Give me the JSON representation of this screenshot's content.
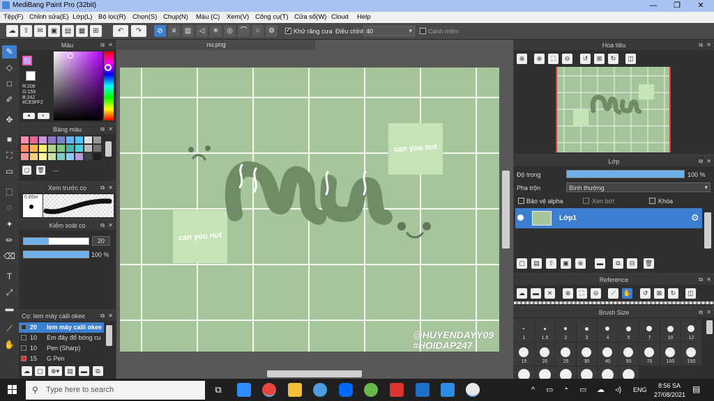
{
  "window": {
    "title": "MediBang Paint Pro (32bit)"
  },
  "menu": [
    "Tệp(F)",
    "Chỉnh sửa(E)",
    "Lớp(L)",
    "Bộ lọc(R)",
    "Chọn(S)",
    "Chụp(N)",
    "Màu (C)",
    "Xem(V)",
    "Công cụ(T)",
    "Cửa sổ(W)",
    "Cloud",
    "Help"
  ],
  "toolbar": {
    "antialias_label": "Khử răng cưa",
    "correction_label": "Điều chỉnh",
    "correction_value": "40",
    "edge_label": "Canh mềm"
  },
  "color_panel": {
    "title": "Màu",
    "r": "R:206",
    "g": "G:159",
    "b": "B:242",
    "hex": "#CE9FF2",
    "accent": "#CE9FF2"
  },
  "palette_panel": {
    "title": "Bảng màu",
    "dash": "---"
  },
  "preview_panel": {
    "title": "Xem trước cọ",
    "size": "0.85m"
  },
  "brush_ctrl_panel": {
    "title": "Kiểm soát cọ",
    "size_value": "20",
    "opacity_value": "100 %"
  },
  "brush_list_panel": {
    "title": "Cọ: Iem mày calli okee",
    "items": [
      {
        "size": "20",
        "name": "Iem mày calli okee",
        "color": "#303030"
      },
      {
        "size": "10",
        "name": "Em đây đổ bóng cu",
        "color": "#303030"
      },
      {
        "size": "10",
        "name": "Pen (Sharp)",
        "color": "#303030"
      },
      {
        "size": "15",
        "name": "G Pen",
        "color": "#e03030"
      }
    ]
  },
  "document": {
    "tab": "nu.png"
  },
  "artwork": {
    "square_text_1": "can you not",
    "square_text_2": "can you not",
    "watermark_1": "@HUYENDAYY09",
    "watermark_2": "#HOIDAP247"
  },
  "navigator_panel": {
    "title": "Hoa tiêu"
  },
  "layer_panel": {
    "title": "Lớp",
    "opacity_label": "Độ trong",
    "opacity_value": "100 %",
    "opacity_fraction": 1.0,
    "blend_label": "Pha trộn",
    "blend_value": "Bình thường",
    "protect_alpha": "Bảo vệ alpha",
    "clipping": "Xén bớt",
    "lock": "Khóa",
    "layer_name": "Lớp1"
  },
  "reference_panel": {
    "title": "Reference"
  },
  "brush_size_panel": {
    "title": "Brush Size",
    "row1": [
      "1",
      "1.5",
      "2",
      "3",
      "4",
      "5",
      "7",
      "10",
      "12"
    ],
    "row2": [
      "15",
      "20",
      "25",
      "30",
      "40",
      "50",
      "70",
      "100",
      "150"
    ]
  },
  "taskbar": {
    "search_placeholder": "Type here to search",
    "lang": "ENG",
    "time": "8:56 SA",
    "date": "27/08/2021"
  }
}
